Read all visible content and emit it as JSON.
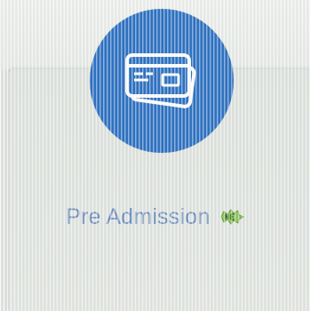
{
  "tile": {
    "label": "Pre Admission",
    "icon": "payment-card-icon",
    "badge_icon": "new-badge-icon"
  },
  "colors": {
    "icon_circle": "#2a6fc2",
    "label_text": "#6e8fbf",
    "badge": "#6fae3a",
    "background": "#e3e6e3"
  }
}
